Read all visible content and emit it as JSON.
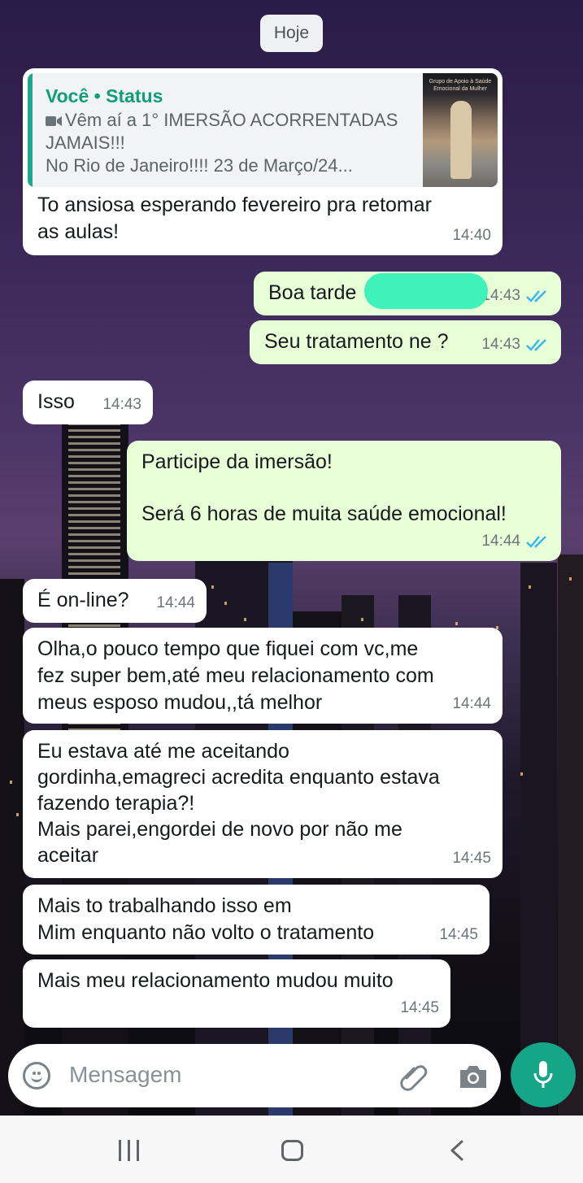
{
  "date_chip": "Hoje",
  "quoted_status": {
    "title": "Você • Status",
    "line1": "Vêm aí a 1° IMERSÃO ACORRENTADAS JAMAIS!!!",
    "line2": "No Rio de Janeiro!!!! 23 de Março/24...",
    "thumb_text": "Grupo de Apoio à Saúde Emocional da Mulher",
    "icon": "video-camera-icon"
  },
  "messages": [
    {
      "dir": "in",
      "text": "To ansiosa esperando fevereiro pra retomar\nas aulas!",
      "time": "14:40"
    },
    {
      "dir": "out",
      "text": "Boa tarde",
      "time": "14:43",
      "status": "read"
    },
    {
      "dir": "out",
      "text": "Seu tratamento ne ?",
      "time": "14:43",
      "status": "read"
    },
    {
      "dir": "in",
      "text": "Isso",
      "time": "14:43"
    },
    {
      "dir": "out",
      "text": "Participe da imersão!\n\nSerá 6 horas de muita saúde emocional!",
      "time": "14:44",
      "status": "read"
    },
    {
      "dir": "in",
      "text": "É on-line?",
      "time": "14:44"
    },
    {
      "dir": "in",
      "text": "Olha,o pouco tempo que fiquei com vc,me\nfez super bem,até meu relacionamento com\nmeus esposo mudou,,tá melhor",
      "time": "14:44"
    },
    {
      "dir": "in",
      "text": "Eu estava até me aceitando\ngordinha,emagreci acredita enquanto estava\nfazendo terapia?!\nMais parei,engordei de novo por não me\naceitar",
      "time": "14:45"
    },
    {
      "dir": "in",
      "text": "Mais to trabalhando isso em\nMim enquanto não volto o tratamento",
      "time": "14:45"
    },
    {
      "dir": "in",
      "text": "Mais meu relacionamento mudou muito",
      "time": "14:45"
    }
  ],
  "composer": {
    "placeholder": "Mensagem",
    "icons": [
      "emoji-icon",
      "paperclip-icon",
      "camera-icon",
      "microphone-icon"
    ]
  },
  "colors": {
    "incoming_bubble": "#ffffff",
    "outgoing_bubble": "#e7fed7",
    "accent": "#15a587",
    "read_ticks": "#34b7f1"
  }
}
